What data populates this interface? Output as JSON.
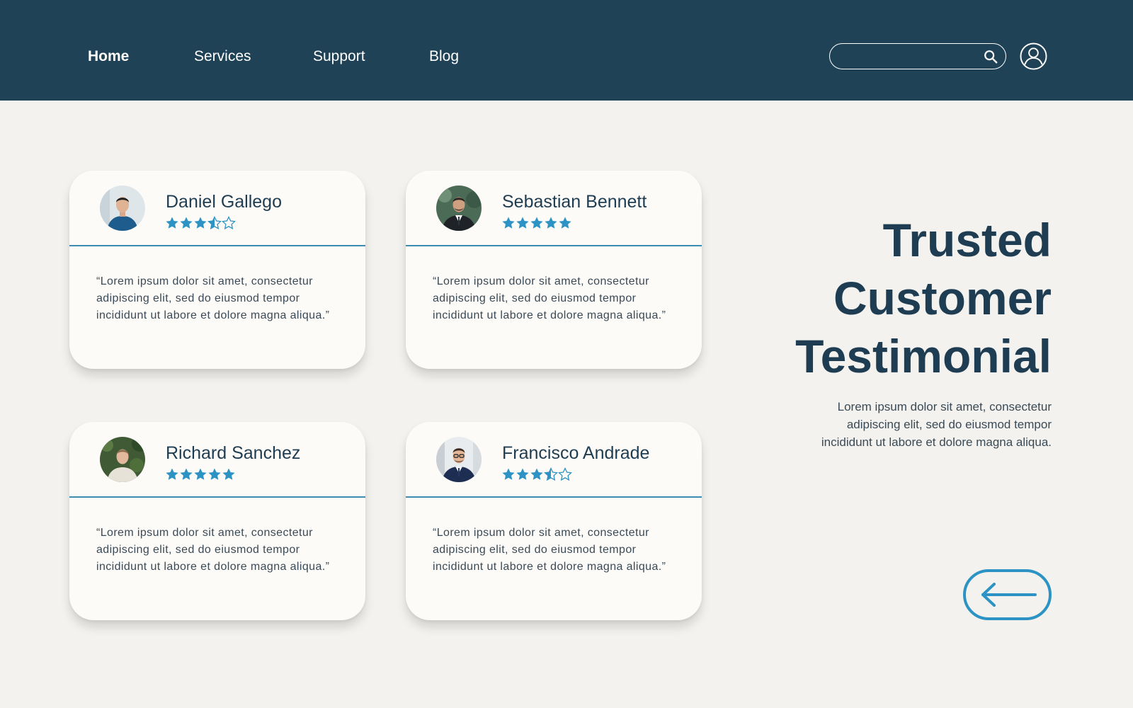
{
  "nav": {
    "items": [
      {
        "label": "Home",
        "active": true
      },
      {
        "label": "Services",
        "active": false
      },
      {
        "label": "Support",
        "active": false
      },
      {
        "label": "Blog",
        "active": false
      }
    ],
    "search": {
      "value": "",
      "placeholder": "",
      "icon": "search-icon"
    },
    "user_icon": "user-circle-icon"
  },
  "testimonials": [
    {
      "name": "Daniel Gallego",
      "rating": 3.5,
      "quote": "“Lorem ipsum dolor sit amet, consectetur adipiscing elit, sed do eiusmod tempor incididunt ut labore et dolore magna aliqua.”"
    },
    {
      "name": "Sebastian Bennett",
      "rating": 5,
      "quote": "“Lorem ipsum dolor sit amet, consectetur adipiscing elit, sed do eiusmod tempor incididunt ut labore et dolore magna aliqua.”"
    },
    {
      "name": "Richard Sanchez",
      "rating": 5,
      "quote": "“Lorem ipsum dolor sit amet, consectetur adipiscing elit, sed do eiusmod tempor incididunt ut labore et dolore magna aliqua.”"
    },
    {
      "name": "Francisco Andrade",
      "rating": 3.5,
      "quote": "“Lorem ipsum dolor sit amet, consectetur adipiscing elit, sed do eiusmod tempor incididunt ut labore et dolore magna aliqua.”"
    }
  ],
  "hero": {
    "title_lines": [
      "Trusted",
      "Customer",
      "Testimonial"
    ],
    "description": "Lorem ipsum dolor sit amet, consectetur adipiscing elit, sed do eiusmod tempor incididunt ut labore et dolore magna aliqua."
  },
  "back_button": {
    "icon": "arrow-left-icon"
  },
  "colors": {
    "header_bg": "#1f4257",
    "page_bg": "#f3f2ee",
    "card_bg": "#fdfbf8",
    "accent": "#2d93c4",
    "heading": "#1f3d52"
  }
}
